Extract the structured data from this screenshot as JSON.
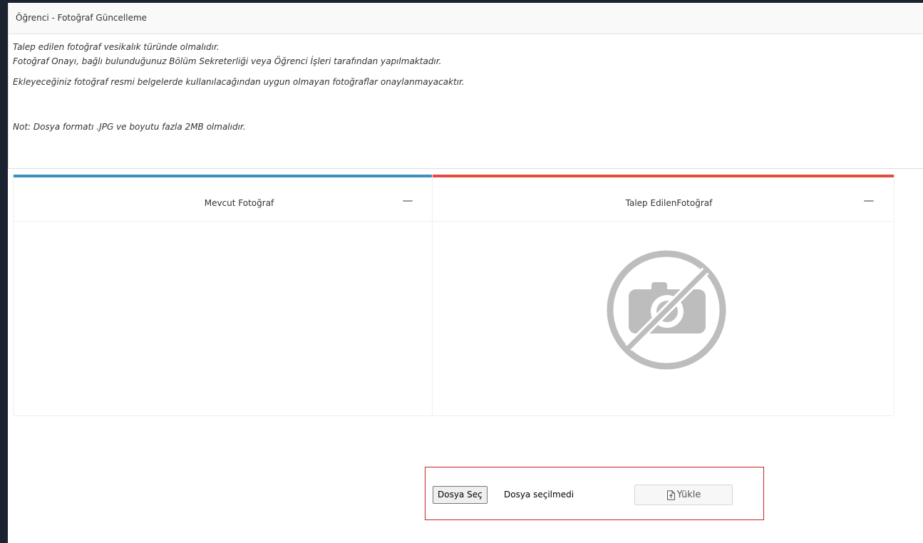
{
  "portlet": {
    "title": "Öğrenci - Fotoğraf Güncelleme",
    "notes": [
      "Talep edilen fotoğraf vesikalık türünde olmalıdır.",
      "Fotoğraf Onayı, bağlı bulunduğunuz Bölüm Sekreterliği veya Öğrenci İşleri tarafından yapılmaktadır.",
      "Ekleyeceğiniz fotoğraf resmi belgelerde kullanılacağından uygun olmayan fotoğraflar onaylanmayacaktır."
    ],
    "footnote": "Not: Dosya formatı .JPG ve boyutu fazla 2MB olmalıdır."
  },
  "panels": {
    "current": {
      "title": "Mevcut Fotoğraf",
      "accent": "#3f8fc4"
    },
    "requested": {
      "title": "Talep EdilenFotoğraf",
      "accent": "#e14c3e",
      "image_icon": "no-camera-icon"
    }
  },
  "upload": {
    "choose_label": "Dosya Seç",
    "status": "Dosya seçilmedi",
    "upload_label": "Yükle",
    "highlight_color": "#cc1f1f"
  }
}
